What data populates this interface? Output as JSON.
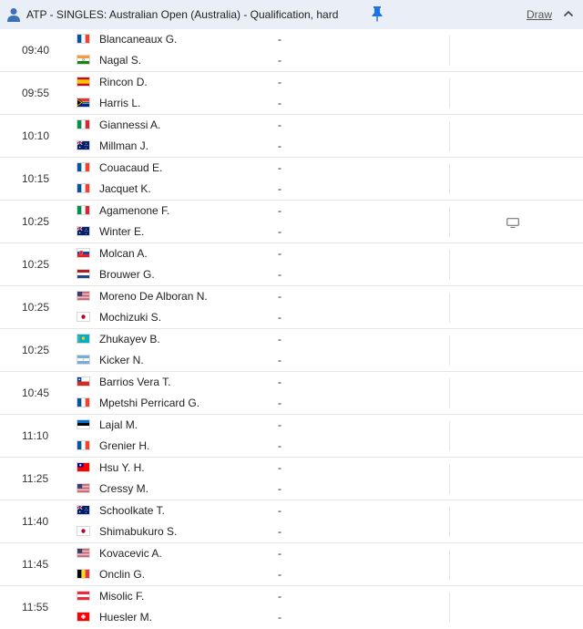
{
  "header": {
    "category": "ATP - SINGLES:",
    "tournament": "Australian Open (Australia) - Qualification, hard",
    "draw_label": "Draw",
    "person_icon": "person-icon",
    "pin_icon": "pin-icon",
    "collapse_icon": "chevron-up-icon",
    "accent_color": "#1a73e8"
  },
  "matches": [
    {
      "time": "09:40",
      "p1": {
        "name": "Blancaneaux G.",
        "flag": "fr",
        "score": "-"
      },
      "p2": {
        "name": "Nagal S.",
        "flag": "in",
        "score": "-"
      },
      "tv": false
    },
    {
      "time": "09:55",
      "p1": {
        "name": "Rincon D.",
        "flag": "es",
        "score": "-"
      },
      "p2": {
        "name": "Harris L.",
        "flag": "za",
        "score": "-"
      },
      "tv": false
    },
    {
      "time": "10:10",
      "p1": {
        "name": "Giannessi A.",
        "flag": "it",
        "score": "-"
      },
      "p2": {
        "name": "Millman J.",
        "flag": "au",
        "score": "-"
      },
      "tv": false
    },
    {
      "time": "10:15",
      "p1": {
        "name": "Couacaud E.",
        "flag": "fr",
        "score": "-"
      },
      "p2": {
        "name": "Jacquet K.",
        "flag": "fr",
        "score": "-"
      },
      "tv": false
    },
    {
      "time": "10:25",
      "p1": {
        "name": "Agamenone F.",
        "flag": "it",
        "score": "-"
      },
      "p2": {
        "name": "Winter E.",
        "flag": "au",
        "score": "-"
      },
      "tv": true
    },
    {
      "time": "10:25",
      "p1": {
        "name": "Molcan A.",
        "flag": "sk",
        "score": "-"
      },
      "p2": {
        "name": "Brouwer G.",
        "flag": "nl",
        "score": "-"
      },
      "tv": false
    },
    {
      "time": "10:25",
      "p1": {
        "name": "Moreno De Alboran N.",
        "flag": "us",
        "score": "-"
      },
      "p2": {
        "name": "Mochizuki S.",
        "flag": "jp",
        "score": "-"
      },
      "tv": false
    },
    {
      "time": "10:25",
      "p1": {
        "name": "Zhukayev B.",
        "flag": "kz",
        "score": "-"
      },
      "p2": {
        "name": "Kicker N.",
        "flag": "ar",
        "score": "-"
      },
      "tv": false
    },
    {
      "time": "10:45",
      "p1": {
        "name": "Barrios Vera T.",
        "flag": "cl",
        "score": "-"
      },
      "p2": {
        "name": "Mpetshi Perricard G.",
        "flag": "fr",
        "score": "-"
      },
      "tv": false
    },
    {
      "time": "11:10",
      "p1": {
        "name": "Lajal M.",
        "flag": "ee",
        "score": "-"
      },
      "p2": {
        "name": "Grenier H.",
        "flag": "fr",
        "score": "-"
      },
      "tv": false
    },
    {
      "time": "11:25",
      "p1": {
        "name": "Hsu Y. H.",
        "flag": "tw",
        "score": "-"
      },
      "p2": {
        "name": "Cressy M.",
        "flag": "us",
        "score": "-"
      },
      "tv": false
    },
    {
      "time": "11:40",
      "p1": {
        "name": "Schoolkate T.",
        "flag": "au",
        "score": "-"
      },
      "p2": {
        "name": "Shimabukuro S.",
        "flag": "jp",
        "score": "-"
      },
      "tv": false
    },
    {
      "time": "11:45",
      "p1": {
        "name": "Kovacevic A.",
        "flag": "us",
        "score": "-"
      },
      "p2": {
        "name": "Onclin G.",
        "flag": "be",
        "score": "-"
      },
      "tv": false
    },
    {
      "time": "11:55",
      "p1": {
        "name": "Misolic F.",
        "flag": "at",
        "score": "-"
      },
      "p2": {
        "name": "Huesler M.",
        "flag": "ch",
        "score": "-"
      },
      "tv": false
    }
  ]
}
